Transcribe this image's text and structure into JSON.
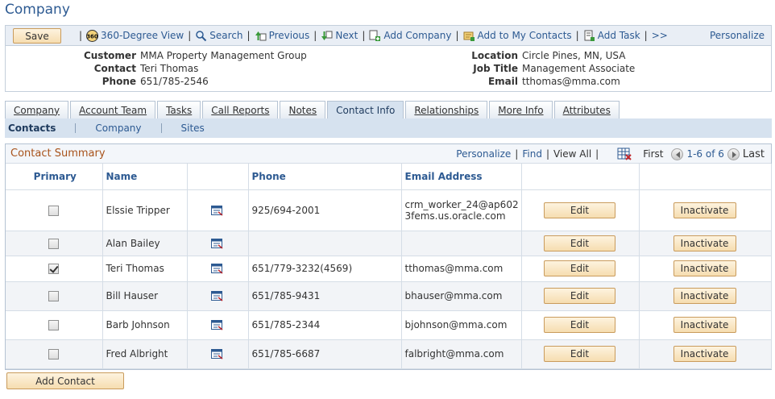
{
  "page": {
    "title": "Company"
  },
  "toolbar": {
    "save_label": "Save",
    "links": [
      {
        "label": "360-Degree View",
        "icon": "360-icon"
      },
      {
        "label": "Search",
        "icon": "search-icon"
      },
      {
        "label": "Previous",
        "icon": "previous-icon"
      },
      {
        "label": "Next",
        "icon": "next-icon"
      },
      {
        "label": "Add Company",
        "icon": "add-company-icon"
      },
      {
        "label": "Add to My Contacts",
        "icon": "add-contacts-icon"
      },
      {
        "label": "Add Task",
        "icon": "add-task-icon"
      }
    ],
    "more_label": ">>",
    "personalize_label": "Personalize"
  },
  "header": {
    "customer_label": "Customer",
    "customer": "MMA Property Management Group",
    "contact_label": "Contact",
    "contact": "Teri Thomas",
    "phone_label": "Phone",
    "phone": "651/785-2546",
    "location_label": "Location",
    "location": "Circle Pines, MN, USA",
    "job_title_label": "Job Title",
    "job_title": "Management Associate",
    "email_label": "Email",
    "email": "tthomas@mma.com"
  },
  "tabs": [
    "Company",
    "Account Team",
    "Tasks",
    "Call Reports",
    "Notes",
    "Contact Info",
    "Relationships",
    "More Info",
    "Attributes"
  ],
  "active_tab": "Contact Info",
  "subtabs": [
    "Contacts",
    "Company",
    "Sites"
  ],
  "grid": {
    "title": "Contact Summary",
    "personalize": "Personalize",
    "find": "Find",
    "view_all": "View All",
    "first": "First",
    "range": "1-6 of 6",
    "last": "Last",
    "columns": {
      "primary": "Primary",
      "name": "Name",
      "phone": "Phone",
      "email": "Email Address"
    },
    "edit_label": "Edit",
    "inactivate_label": "Inactivate",
    "rows": [
      {
        "primary": false,
        "name": "Elssie Tripper",
        "phone": "925/694-2001",
        "email": "crm_worker_24@ap6023fems.us.oracle.com"
      },
      {
        "primary": false,
        "name": "Alan Bailey",
        "phone": "",
        "email": ""
      },
      {
        "primary": true,
        "name": "Teri Thomas",
        "phone": "651/779-3232(4569)",
        "email": "tthomas@mma.com"
      },
      {
        "primary": false,
        "name": "Bill Hauser",
        "phone": "651/785-9431",
        "email": "bhauser@mma.com"
      },
      {
        "primary": false,
        "name": "Barb Johnson",
        "phone": "651/785-2344",
        "email": "bjohnson@mma.com"
      },
      {
        "primary": false,
        "name": "Fred Albright",
        "phone": "651/785-6687",
        "email": "falbright@mma.com"
      }
    ]
  },
  "add_contact_label": "Add Contact"
}
